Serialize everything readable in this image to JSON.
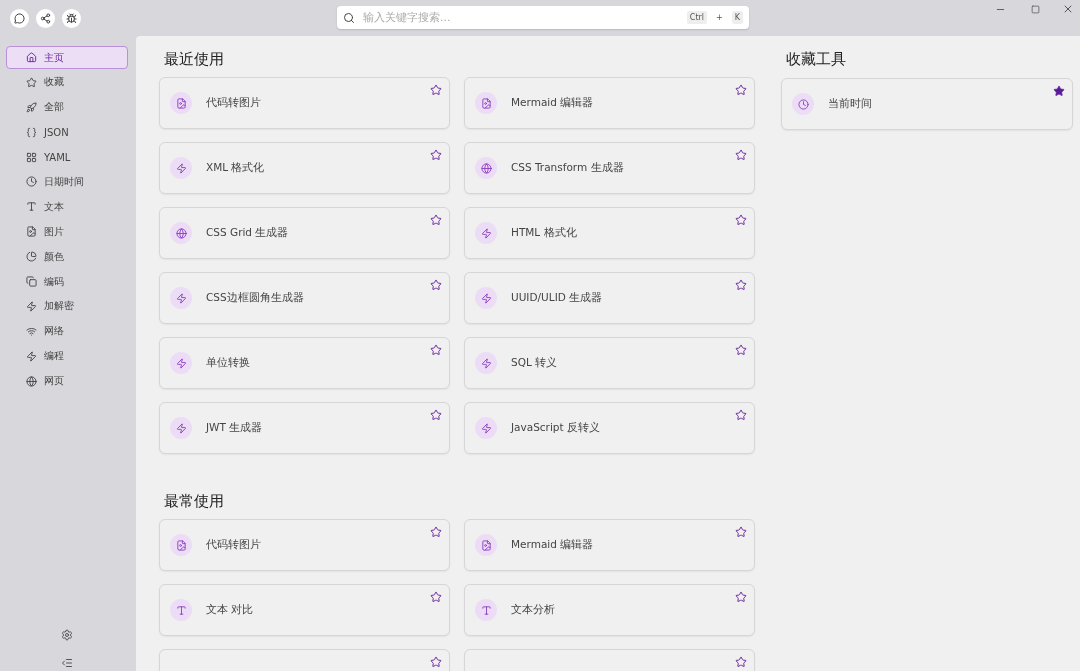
{
  "toolbar": {
    "search": {
      "placeholder": "输入关键字搜索...",
      "shortcut": [
        "Ctrl",
        "+",
        "K"
      ]
    }
  },
  "sidebar": {
    "items": [
      {
        "label": "主页",
        "kind": "home",
        "selected": true
      },
      {
        "label": "收藏",
        "kind": "star",
        "selected": false
      },
      {
        "label": "全部",
        "kind": "rocket",
        "selected": false
      },
      {
        "label": "JSON",
        "kind": "braces",
        "selected": false
      },
      {
        "label": "YAML",
        "kind": "grid",
        "selected": false
      },
      {
        "label": "日期时间",
        "kind": "clock",
        "selected": false
      },
      {
        "label": "文本",
        "kind": "type",
        "selected": false
      },
      {
        "label": "图片",
        "kind": "file",
        "selected": false
      },
      {
        "label": "颜色",
        "kind": "pie",
        "selected": false
      },
      {
        "label": "编码",
        "kind": "copy",
        "selected": false
      },
      {
        "label": "加解密",
        "kind": "zap",
        "selected": false
      },
      {
        "label": "网络",
        "kind": "wifi",
        "selected": false
      },
      {
        "label": "编程",
        "kind": "zap",
        "selected": false
      },
      {
        "label": "网页",
        "kind": "globe",
        "selected": false
      }
    ]
  },
  "sections": [
    {
      "title": "最近使用",
      "tools": [
        {
          "name": "代码转图片",
          "kind": "file",
          "favorite": false
        },
        {
          "name": "Mermaid 编辑器",
          "kind": "file",
          "favorite": false
        },
        {
          "name": "XML 格式化",
          "kind": "zap",
          "favorite": false
        },
        {
          "name": "CSS Transform 生成器",
          "kind": "globe",
          "favorite": false
        },
        {
          "name": "CSS Grid 生成器",
          "kind": "globe",
          "favorite": false
        },
        {
          "name": "HTML 格式化",
          "kind": "zap",
          "favorite": false
        },
        {
          "name": "CSS边框圆角生成器",
          "kind": "zap",
          "favorite": false
        },
        {
          "name": "UUID/ULID 生成器",
          "kind": "zap",
          "favorite": false
        },
        {
          "name": "单位转换",
          "kind": "zap",
          "favorite": false
        },
        {
          "name": "SQL 转义",
          "kind": "zap",
          "favorite": false
        },
        {
          "name": "JWT 生成器",
          "kind": "zap",
          "favorite": false
        },
        {
          "name": "JavaScript 反转义",
          "kind": "zap",
          "favorite": false
        }
      ]
    },
    {
      "title": "最常使用",
      "tools": [
        {
          "name": "代码转图片",
          "kind": "file",
          "favorite": false
        },
        {
          "name": "Mermaid 编辑器",
          "kind": "file",
          "favorite": false
        },
        {
          "name": "文本 对比",
          "kind": "type",
          "favorite": false
        },
        {
          "name": "文本分析",
          "kind": "type",
          "favorite": false
        },
        {
          "favorite": false
        },
        {
          "favorite": false
        }
      ]
    }
  ],
  "favorites": {
    "title": "收藏工具",
    "tools": [
      {
        "name": "当前时间",
        "kind": "clock",
        "favorite": true
      }
    ]
  }
}
